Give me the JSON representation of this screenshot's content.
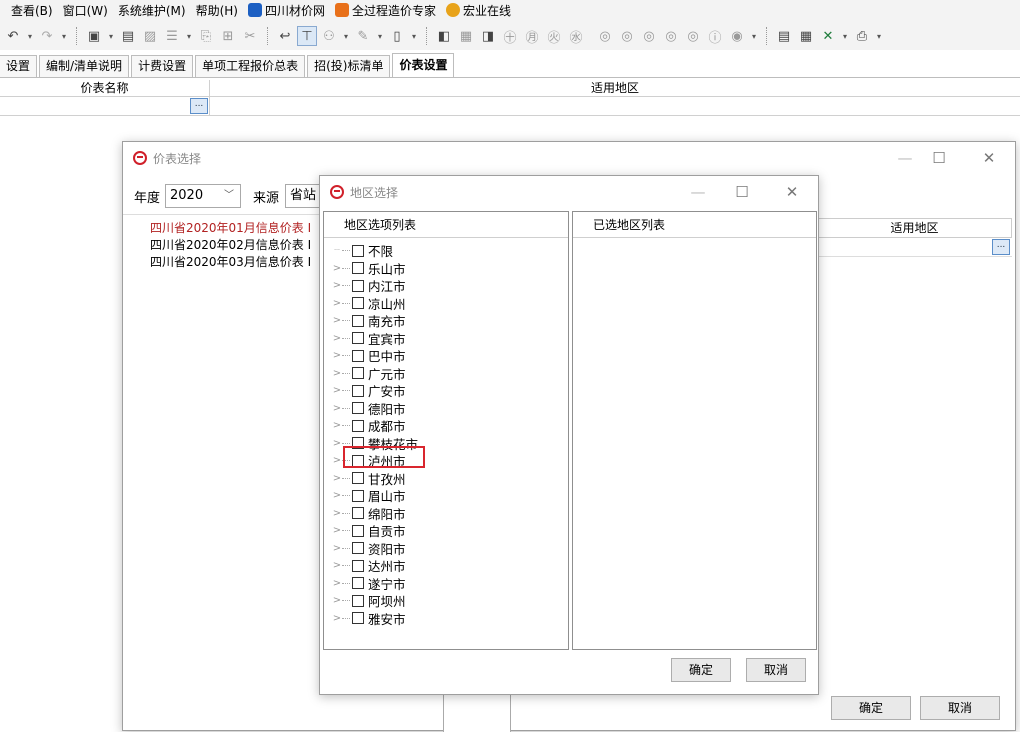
{
  "menubar": {
    "items": [
      "查看(B)",
      "窗口(W)",
      "系统维护(M)",
      "帮助(H)",
      "四川材价网",
      "全过程造价专家",
      "宏业在线"
    ]
  },
  "tabs": [
    "设置",
    "编制/清单说明",
    "计费设置",
    "单项工程报价总表",
    "招(投)标清单",
    "价表设置"
  ],
  "active_tab_index": 5,
  "main_grid": {
    "col_name": "价表名称",
    "col_region": "适用地区",
    "ellipsis": "..."
  },
  "price_dialog": {
    "title": "价表选择",
    "year_label": "年度",
    "year_value": "2020",
    "source_label": "来源",
    "source_value": "省站",
    "items": [
      "四川省2020年01月信息价表 I",
      "四川省2020年02月信息价表 I",
      "四川省2020年03月信息价表 I"
    ],
    "region_col": "适用地区",
    "ellipsis": "...",
    "ok": "确定",
    "cancel": "取消"
  },
  "region_dialog": {
    "title": "地区选择",
    "options_header": "地区选项列表",
    "selected_header": "已选地区列表",
    "regions": [
      "不限",
      "乐山市",
      "内江市",
      "凉山州",
      "南充市",
      "宜宾市",
      "巴中市",
      "广元市",
      "广安市",
      "德阳市",
      "成都市",
      "攀枝花市",
      "泸州市",
      "甘孜州",
      "眉山市",
      "绵阳市",
      "自贡市",
      "资阳市",
      "达州市",
      "遂宁市",
      "阿坝州",
      "雅安市"
    ],
    "highlighted": "泸州市",
    "ok": "确定",
    "cancel": "取消"
  },
  "colors": {
    "accent_red": "#d9262e",
    "first_item_red": "#b22222",
    "logo_red": "#d0202a"
  }
}
